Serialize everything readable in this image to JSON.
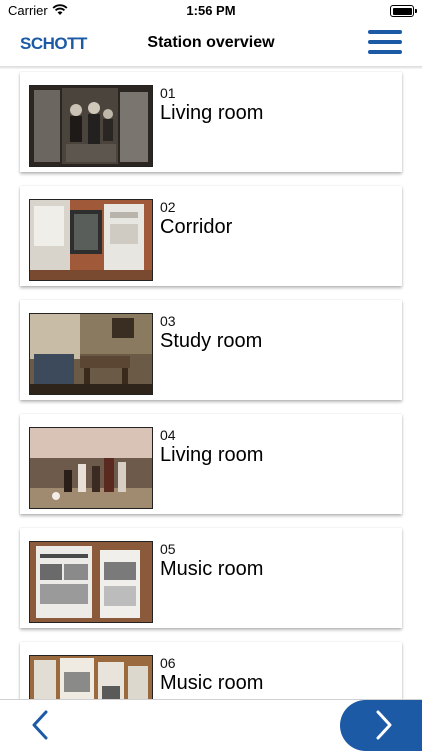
{
  "status": {
    "carrier": "Carrier",
    "time": "1:56 PM"
  },
  "header": {
    "logo": "SCHOTT",
    "title": "Station overview",
    "menu_icon": "hamburger-menu-icon"
  },
  "stations": [
    {
      "number": "01",
      "name": "Living room"
    },
    {
      "number": "02",
      "name": "Corridor"
    },
    {
      "number": "03",
      "name": "Study room"
    },
    {
      "number": "04",
      "name": "Living room"
    },
    {
      "number": "05",
      "name": "Music room"
    },
    {
      "number": "06",
      "name": "Music room"
    }
  ],
  "footer": {
    "back_icon": "chevron-left-icon",
    "forward_icon": "chevron-right-icon"
  },
  "colors": {
    "accent": "#1c5aa6"
  }
}
